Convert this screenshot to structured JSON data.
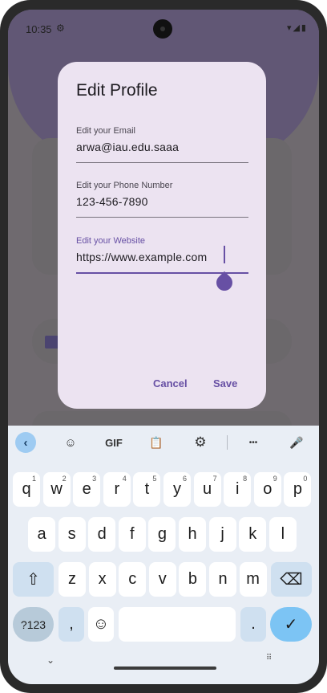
{
  "status": {
    "time": "10:35",
    "settings_icon": "⚙",
    "right_icons": "▾◢▮"
  },
  "dialog": {
    "title": "Edit Profile",
    "fields": [
      {
        "label": "Edit your Email",
        "value": "arwa@iau.edu.saaa"
      },
      {
        "label": "Edit your Phone Number",
        "value": "123-456-7890"
      },
      {
        "label": "Edit your Website",
        "value": "https://www.example.com"
      }
    ],
    "cancel_label": "Cancel",
    "save_label": "Save"
  },
  "keyboard": {
    "toolbar": {
      "back": "‹",
      "sticker": "☺",
      "gif": "GIF",
      "clipboard": "📋",
      "settings": "⚙",
      "more": "•••",
      "mic": "🎤"
    },
    "row1": [
      {
        "k": "q",
        "h": "1"
      },
      {
        "k": "w",
        "h": "2"
      },
      {
        "k": "e",
        "h": "3"
      },
      {
        "k": "r",
        "h": "4"
      },
      {
        "k": "t",
        "h": "5"
      },
      {
        "k": "y",
        "h": "6"
      },
      {
        "k": "u",
        "h": "7"
      },
      {
        "k": "i",
        "h": "8"
      },
      {
        "k": "o",
        "h": "9"
      },
      {
        "k": "p",
        "h": "0"
      }
    ],
    "row2": [
      "a",
      "s",
      "d",
      "f",
      "g",
      "h",
      "j",
      "k",
      "l"
    ],
    "row3": [
      "z",
      "x",
      "c",
      "v",
      "b",
      "n",
      "m"
    ],
    "shift": "⇧",
    "backspace": "⌫",
    "symbols": "?123",
    "comma": ",",
    "emoji": "☺",
    "period": ".",
    "enter": "✓"
  },
  "nav": {
    "down": "⌄",
    "grid": "⠿"
  },
  "colors": {
    "accent": "#6750a4",
    "dialog_bg": "#ece3f1",
    "keyboard_bg": "#e9eef5"
  }
}
